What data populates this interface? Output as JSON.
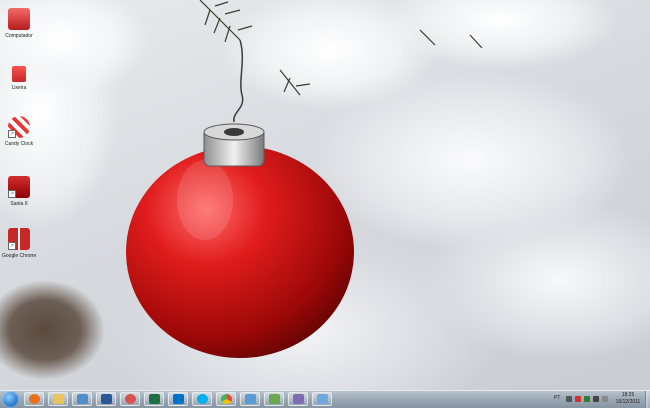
{
  "desktop": {
    "icons": [
      {
        "label": "Computador",
        "icon": "computer-icon",
        "color": "#d23b3b",
        "shortcut": false
      },
      {
        "label": "Lixeira",
        "icon": "recycle-bin-icon",
        "color": "#d42020",
        "shortcut": false
      },
      {
        "label": "Candy Clock",
        "icon": "candy-cane-icon",
        "color": "#e23a3a",
        "shortcut": true
      },
      {
        "label": "Santa II",
        "icon": "santa-icon",
        "color": "#c62828",
        "shortcut": true
      },
      {
        "label": "Google Chrome",
        "icon": "gift-box-icon",
        "color": "#b71c1c",
        "shortcut": true
      }
    ]
  },
  "taskbar": {
    "start": "start-orb-icon",
    "items": [
      {
        "name": "firefox",
        "color": "#e8701a"
      },
      {
        "name": "explorer",
        "color": "#e9c45a"
      },
      {
        "name": "libraries",
        "color": "#4f8ec9"
      },
      {
        "name": "word",
        "color": "#2b5797"
      },
      {
        "name": "paint",
        "color": "#d9534f"
      },
      {
        "name": "excel",
        "color": "#1e7145"
      },
      {
        "name": "outlook",
        "color": "#0072c6"
      },
      {
        "name": "skype",
        "color": "#00aff0"
      },
      {
        "name": "chrome",
        "color": "#dd4b39"
      },
      {
        "name": "photos",
        "color": "#5b9bd5"
      },
      {
        "name": "media",
        "color": "#6aa84f"
      },
      {
        "name": "network",
        "color": "#7f6bb0"
      },
      {
        "name": "remote",
        "color": "#6fa8dc"
      }
    ],
    "tray": {
      "label": "PT",
      "time": "18:25",
      "date": "16/12/2011"
    }
  }
}
